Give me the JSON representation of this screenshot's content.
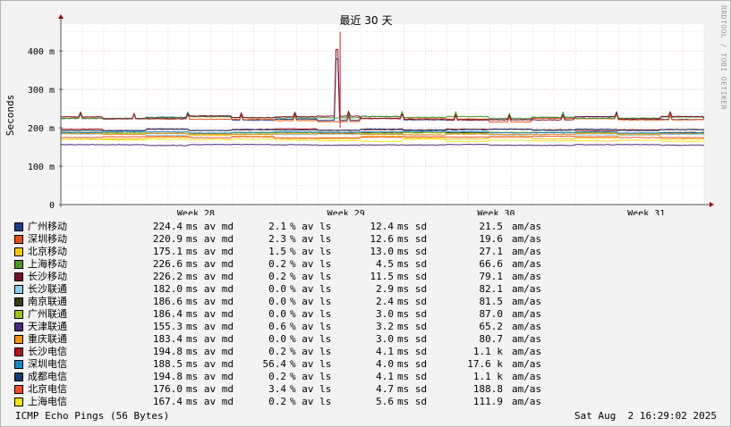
{
  "chart_data": {
    "type": "line",
    "title": "最近 30 天",
    "ylabel": "Seconds",
    "ylim": [
      0,
      470
    ],
    "y_unit_suffix": "m",
    "yticks": [
      0,
      100,
      200,
      300,
      400
    ],
    "xlim": [
      0,
      30
    ],
    "x_ticks": [
      {
        "label": "Week 28",
        "day": 6.3
      },
      {
        "label": "Week 29",
        "day": 13.3
      },
      {
        "label": "Week 30",
        "day": 20.3
      },
      {
        "label": "Week 31",
        "day": 27.3
      }
    ],
    "grid": true,
    "series": [
      {
        "name": "广州移动",
        "color": "#1f3e8a",
        "median": 224.4,
        "avg_loss": "2.1",
        "std_dev": "12.4",
        "loss_per": "21.5",
        "loss_unit": "am/as"
      },
      {
        "name": "深圳移动",
        "color": "#e5521b",
        "median": 220.9,
        "avg_loss": "2.3",
        "std_dev": "12.6",
        "loss_per": "19.6",
        "loss_unit": "am/as"
      },
      {
        "name": "北京移动",
        "color": "#f3c80a",
        "median": 175.1,
        "avg_loss": "1.5",
        "std_dev": "13.0",
        "loss_per": "27.1",
        "loss_unit": "am/as"
      },
      {
        "name": "上海移动",
        "color": "#4c9a2a",
        "median": 226.6,
        "avg_loss": "0.2",
        "std_dev": "4.5",
        "loss_per": "66.6",
        "loss_unit": "am/as"
      },
      {
        "name": "长沙移动",
        "color": "#7a0f2b",
        "median": 226.2,
        "avg_loss": "0.2",
        "std_dev": "11.5",
        "loss_per": "79.1",
        "loss_unit": "am/as"
      },
      {
        "name": "长沙联通",
        "color": "#8ecbf0",
        "median": 182.0,
        "avg_loss": "0.0",
        "std_dev": "2.9",
        "loss_per": "82.1",
        "loss_unit": "am/as"
      },
      {
        "name": "南京联通",
        "color": "#3a3a0f",
        "median": 186.6,
        "avg_loss": "0.0",
        "std_dev": "2.4",
        "loss_per": "81.5",
        "loss_unit": "am/as"
      },
      {
        "name": "广州联通",
        "color": "#9cc41f",
        "median": 186.4,
        "avg_loss": "0.0",
        "std_dev": "3.0",
        "loss_per": "87.0",
        "loss_unit": "am/as"
      },
      {
        "name": "天津联通",
        "color": "#4a2a7a",
        "median": 155.3,
        "avg_loss": "0.6",
        "std_dev": "3.2",
        "loss_per": "65.2",
        "loss_unit": "am/as"
      },
      {
        "name": "重庆联通",
        "color": "#f39419",
        "median": 183.4,
        "avg_loss": "0.0",
        "std_dev": "3.0",
        "loss_per": "80.7",
        "loss_unit": "am/as"
      },
      {
        "name": "长沙电信",
        "color": "#b0141a",
        "median": 194.8,
        "avg_loss": "0.2",
        "std_dev": "4.1",
        "loss_per": "1.1 k",
        "loss_unit": "am/as"
      },
      {
        "name": "深圳电信",
        "color": "#1a86c8",
        "median": 188.5,
        "avg_loss": "56.4",
        "std_dev": "4.0",
        "loss_per": "17.6 k",
        "loss_unit": "am/as"
      },
      {
        "name": "成都电信",
        "color": "#123c6e",
        "median": 194.8,
        "avg_loss": "0.2",
        "std_dev": "4.1",
        "loss_per": "1.1 k",
        "loss_unit": "am/as"
      },
      {
        "name": "北京电信",
        "color": "#f0502a",
        "median": 176.0,
        "avg_loss": "3.4",
        "std_dev": "4.7",
        "loss_per": "188.8",
        "loss_unit": "am/as"
      },
      {
        "name": "上海电信",
        "color": "#f6e21a",
        "median": 167.4,
        "avg_loss": "0.2",
        "std_dev": "5.6",
        "loss_per": "111.9",
        "loss_unit": "am/as"
      }
    ],
    "spike": {
      "day": 12.9,
      "peak": 450
    }
  },
  "legend_units": {
    "med": "ms av md",
    "avg": "% av ls",
    "sd": "ms sd"
  },
  "footer": {
    "left": "ICMP Echo Pings (56 Bytes)",
    "right": "Sat Aug  2 16:29:02 2025"
  },
  "watermark": "RRDTOOL / TOBI OETIKER"
}
